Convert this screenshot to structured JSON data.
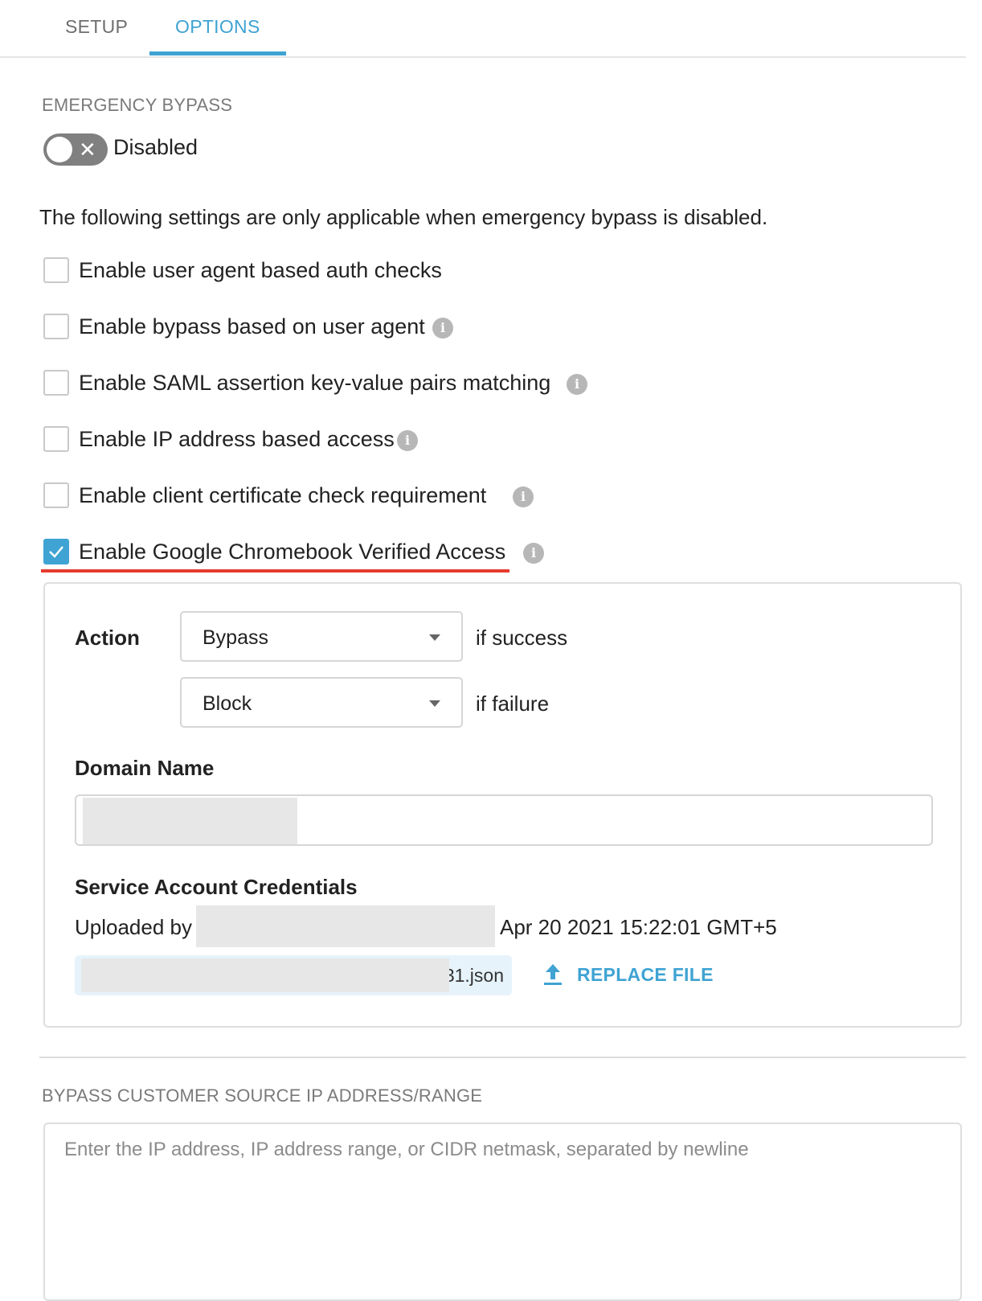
{
  "tabs": [
    {
      "label": "SETUP",
      "active": false
    },
    {
      "label": "OPTIONS",
      "active": true
    }
  ],
  "emergency_bypass": {
    "heading": "EMERGENCY BYPASS",
    "toggle_state": "Disabled",
    "toggle_on": false
  },
  "note": "The following settings are only applicable when emergency bypass is disabled.",
  "checkboxes": [
    {
      "label": "Enable user agent based auth checks",
      "checked": false,
      "has_info": false
    },
    {
      "label": "Enable bypass based on user agent",
      "checked": false,
      "has_info": true
    },
    {
      "label": "Enable SAML assertion key-value pairs matching",
      "checked": false,
      "has_info": true
    },
    {
      "label": "Enable IP address based access",
      "checked": false,
      "has_info": true
    },
    {
      "label": "Enable client certificate check requirement",
      "checked": false,
      "has_info": true
    },
    {
      "label": "Enable Google Chromebook Verified Access",
      "checked": true,
      "has_info": true
    }
  ],
  "verified_access": {
    "action_label": "Action",
    "success_action": "Bypass",
    "success_suffix": "if success",
    "failure_action": "Block",
    "failure_suffix": "if failure",
    "domain_label": "Domain Name",
    "domain_value": "",
    "credentials_label": "Service Account Credentials",
    "uploaded_by_prefix": "Uploaded by",
    "uploaded_date": "Apr 20 2021 15:22:01 GMT+5",
    "file_name_suffix": "31.json",
    "replace_label": "REPLACE FILE"
  },
  "bypass_ip": {
    "heading": "BYPASS CUSTOMER SOURCE IP ADDRESS/RANGE",
    "placeholder": "Enter the IP address, IP address range, or CIDR netmask, separated by newline"
  },
  "colors": {
    "accent": "#3fa3d3",
    "highlight_underline": "#e63b2e",
    "toggle_off": "#808080"
  }
}
